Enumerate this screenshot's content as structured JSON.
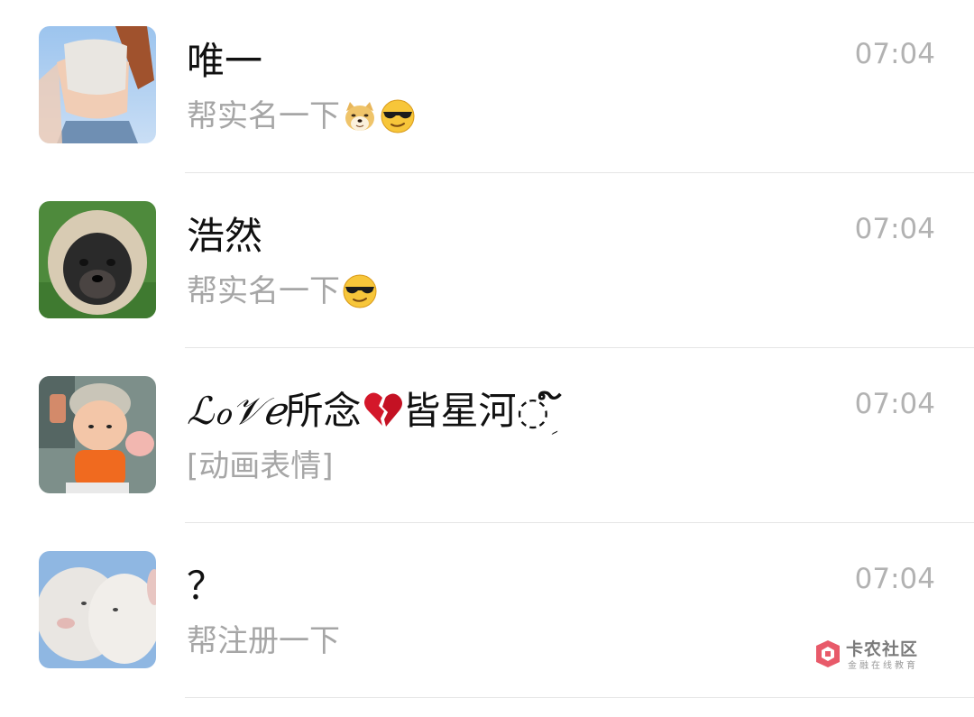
{
  "chats": [
    {
      "name": "唯一",
      "preview_text": "帮实名一下",
      "preview_emojis": [
        "doge-emoji",
        "cool-sunglasses-emoji"
      ],
      "time": "07:04",
      "avatar": "girl-photo-avatar"
    },
    {
      "name": "浩然",
      "preview_text": "帮实名一下",
      "preview_emojis": [
        "cool-sunglasses-emoji"
      ],
      "time": "07:04",
      "avatar": "puppy-photo-avatar"
    },
    {
      "name_part1": "ℒℴ𝒱ℯ",
      "name_part2": "所念",
      "name_part3": "皆星河",
      "name_part4": "◌ؚ ໌",
      "name_icon": "broken-heart-icon",
      "preview_text": "[动画表情]",
      "time": "07:04",
      "avatar": "baby-photo-avatar"
    },
    {
      "name": "？",
      "preview_text": "帮注册一下",
      "time": "07:04",
      "avatar": "lambs-photo-avatar"
    }
  ],
  "watermark": {
    "title": "卡农社区",
    "subtitle": "金融在线教育",
    "icon": "kanong-logo-icon"
  }
}
